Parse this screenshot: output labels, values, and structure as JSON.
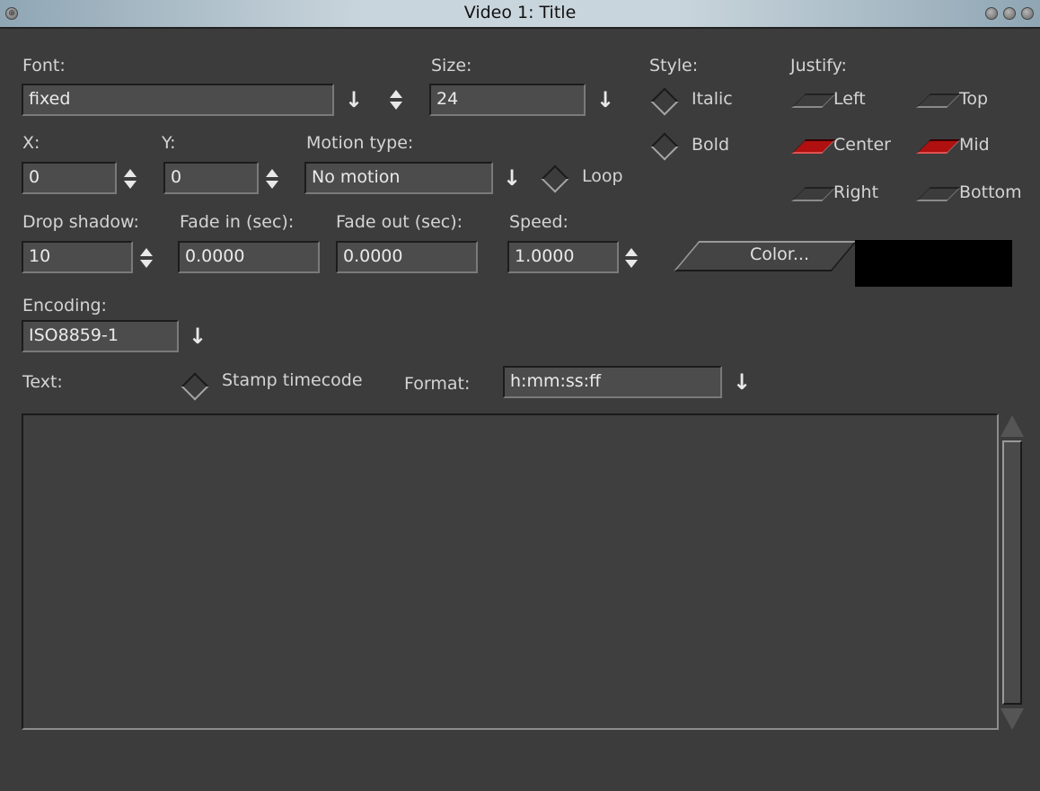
{
  "window": {
    "title": "Video 1: Title"
  },
  "labels": {
    "font": "Font:",
    "size": "Size:",
    "style": "Style:",
    "justify": "Justify:",
    "x": "X:",
    "y": "Y:",
    "motion_type": "Motion type:",
    "drop_shadow": "Drop shadow:",
    "fade_in": "Fade in (sec):",
    "fade_out": "Fade out (sec):",
    "speed": "Speed:",
    "encoding": "Encoding:",
    "text": "Text:",
    "format": "Format:"
  },
  "fields": {
    "font": "fixed",
    "size": "24",
    "x": "0",
    "y": "0",
    "motion": "No motion",
    "drop_shadow": "10",
    "fade_in": "0.0000",
    "fade_out": "0.0000",
    "speed": "1.0000",
    "encoding": "ISO8859-1",
    "format": "h:mm:ss:ff",
    "text": ""
  },
  "style_options": {
    "italic": "Italic",
    "bold": "Bold"
  },
  "checks": {
    "loop": "Loop",
    "stamp_timecode": "Stamp timecode"
  },
  "justify": {
    "left": "Left",
    "center": "Center",
    "right": "Right",
    "top": "Top",
    "mid": "Mid",
    "bottom": "Bottom",
    "selected_horizontal": "Center",
    "selected_vertical": "Mid"
  },
  "color": {
    "button_label": "Color...",
    "swatch": "#000000"
  },
  "icons": {
    "menu": "menu-icon",
    "arrow": "down-arrow-icon",
    "spin": "spinner-icon"
  }
}
